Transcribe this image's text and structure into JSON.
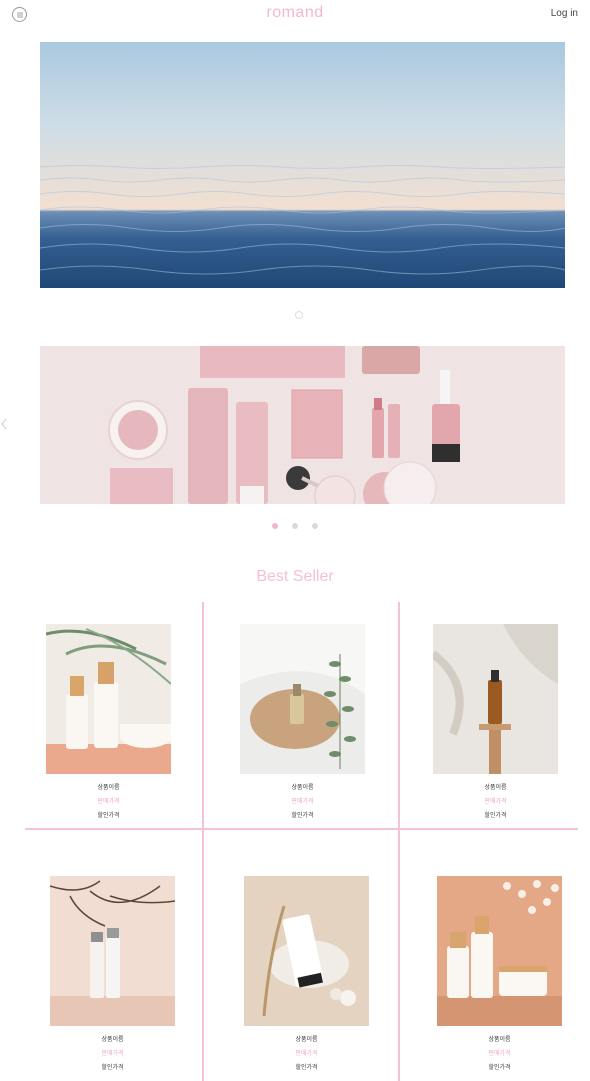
{
  "header": {
    "brand": "romand",
    "login_label": "Log in",
    "menu_icon": "hamburger-icon"
  },
  "best_seller": {
    "title": "Best Seller",
    "products": [
      {
        "name": "상품이름",
        "price": "판매가격",
        "sale_price": "할인가격"
      },
      {
        "name": "상품이름",
        "price": "판매가격",
        "sale_price": "할인가격"
      },
      {
        "name": "상품이름",
        "price": "판매가격",
        "sale_price": "할인가격"
      },
      {
        "name": "상품이름",
        "price": "판매가격",
        "sale_price": "할인가격"
      },
      {
        "name": "상품이름",
        "price": "판매가격",
        "sale_price": "할인가격"
      },
      {
        "name": "상품이름",
        "price": "판매가격",
        "sale_price": "할인가격"
      }
    ]
  },
  "carousel": {
    "slide_count": 3,
    "active_index": 0
  },
  "colors": {
    "brand_pink": "#f3b9c8",
    "divider_pink": "#f3c4d0",
    "dot_inactive": "#d8d8d8"
  }
}
